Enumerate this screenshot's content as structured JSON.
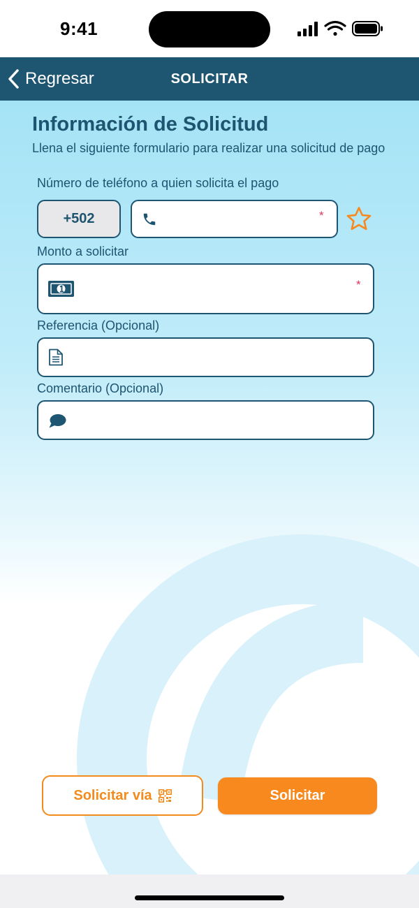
{
  "status_bar": {
    "time": "9:41"
  },
  "nav": {
    "back_label": "Regresar",
    "title": "SOLICITAR"
  },
  "form": {
    "title": "Información de Solicitud",
    "subtitle": "Llena el siguiente formulario para realizar una solicitud de pago",
    "phone": {
      "label": "Número de teléfono a quien solicita el pago",
      "prefix": "+502",
      "value": "",
      "required_mark": "*"
    },
    "amount": {
      "label": "Monto a solicitar",
      "value": "",
      "required_mark": "*"
    },
    "reference": {
      "label": "Referencia (Opcional)",
      "value": ""
    },
    "comment": {
      "label": "Comentario (Opcional)",
      "value": ""
    }
  },
  "actions": {
    "qr_button_label": "Solicitar vía",
    "submit_label": "Solicitar"
  },
  "icons": {
    "back": "chevron-left-icon",
    "phone": "phone-icon",
    "favorite": "star-outline-icon",
    "amount": "banknote-icon",
    "reference": "document-icon",
    "comment": "chat-bubble-icon",
    "qr": "qr-code-icon"
  },
  "colors": {
    "primary": "#1e5571",
    "accent": "#f7891f",
    "required": "#e0365a",
    "background_top": "#a4e3f6"
  }
}
